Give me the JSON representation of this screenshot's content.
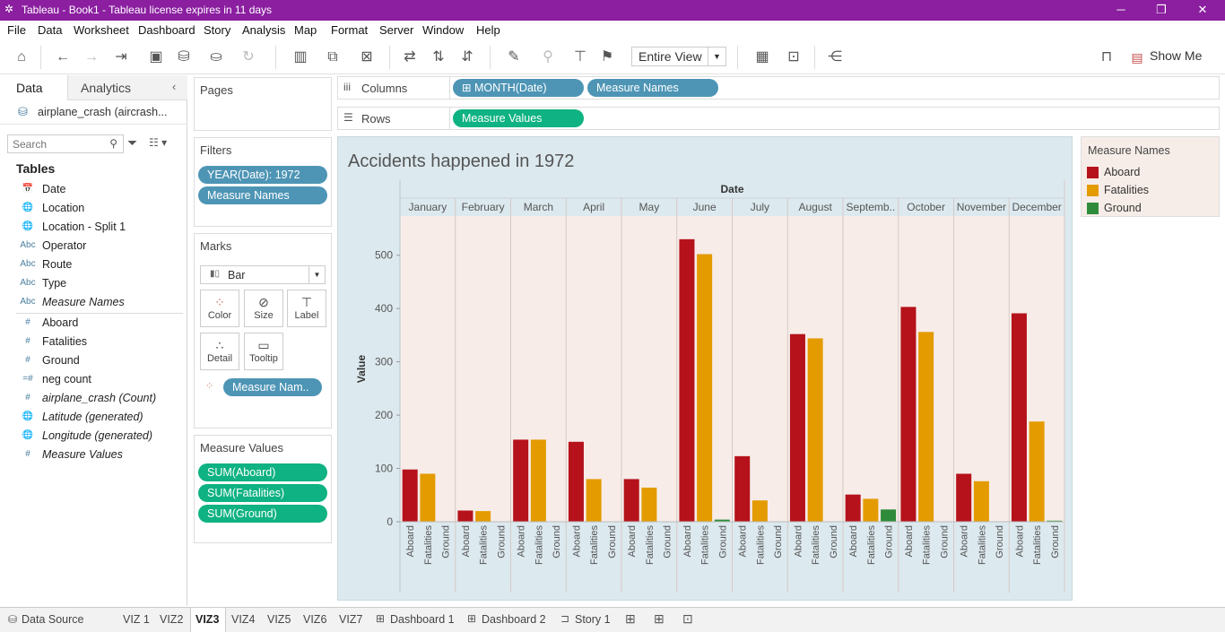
{
  "window": {
    "title": "Tableau - Book1 - Tableau license expires in 11 days",
    "controls": {
      "minimize": "─",
      "restore": "❐",
      "close": "✕"
    }
  },
  "menu": [
    "File",
    "Data",
    "Worksheet",
    "Dashboard",
    "Story",
    "Analysis",
    "Map",
    "Format",
    "Server",
    "Window",
    "Help"
  ],
  "toolbar": {
    "view_select": "Entire View",
    "show_me_label": "Show Me"
  },
  "left_panel": {
    "tabs": {
      "data": "Data",
      "analytics": "Analytics"
    },
    "datasource": "airplane_crash (aircrash...",
    "search_placeholder": "Search",
    "tables_header": "Tables",
    "dimensions": [
      {
        "icon": "📅",
        "name": "Date",
        "italic": false
      },
      {
        "icon": "🌐",
        "name": "Location",
        "italic": false
      },
      {
        "icon": "🌐",
        "name": "Location - Split 1",
        "italic": false
      },
      {
        "icon": "Abc",
        "name": "Operator",
        "italic": false
      },
      {
        "icon": "Abc",
        "name": "Route",
        "italic": false
      },
      {
        "icon": "Abc",
        "name": "Type",
        "italic": false
      },
      {
        "icon": "Abc",
        "name": "Measure Names",
        "italic": true
      }
    ],
    "measures": [
      {
        "icon": "#",
        "name": "Aboard",
        "italic": false
      },
      {
        "icon": "#",
        "name": "Fatalities",
        "italic": false
      },
      {
        "icon": "#",
        "name": "Ground",
        "italic": false
      },
      {
        "icon": "=#",
        "name": "neg count",
        "italic": false
      },
      {
        "icon": "#",
        "name": "airplane_crash (Count)",
        "italic": true
      },
      {
        "icon": "🌐",
        "name": "Latitude (generated)",
        "italic": true
      },
      {
        "icon": "🌐",
        "name": "Longitude (generated)",
        "italic": true
      },
      {
        "icon": "#",
        "name": "Measure Values",
        "italic": true
      }
    ]
  },
  "pages": {
    "header": "Pages"
  },
  "filters": {
    "header": "Filters",
    "items": [
      "YEAR(Date): 1972",
      "Measure Names"
    ]
  },
  "marks": {
    "header": "Marks",
    "mark_type": "Bar",
    "buttons": [
      "Color",
      "Size",
      "Label",
      "Detail",
      "Tooltip"
    ],
    "color_pill": "Measure Nam.."
  },
  "measure_values": {
    "header": "Measure Values",
    "items": [
      "SUM(Aboard)",
      "SUM(Fatalities)",
      "SUM(Ground)"
    ]
  },
  "shelves": {
    "columns_label": "Columns",
    "rows_label": "Rows",
    "columns_pills": [
      "⊞ MONTH(Date)",
      "Measure Names"
    ],
    "rows_pills": [
      "Measure Values"
    ]
  },
  "legend": {
    "title": "Measure Names",
    "items": [
      {
        "name": "Aboard",
        "color": "#b5121b"
      },
      {
        "name": "Fatalities",
        "color": "#e39b00"
      },
      {
        "name": "Ground",
        "color": "#2e8b3a"
      }
    ]
  },
  "chart_data": {
    "type": "bar",
    "title": "Accidents happened in 1972",
    "xlabel": "Date",
    "ylabel": "Value",
    "ylim": [
      0,
      560
    ],
    "yticks": [
      0,
      100,
      200,
      300,
      400,
      500
    ],
    "months": [
      "January",
      "February",
      "March",
      "April",
      "May",
      "June",
      "July",
      "August",
      "Septemb..",
      "October",
      "November",
      "December"
    ],
    "measures": [
      "Aboard",
      "Fatalities",
      "Ground"
    ],
    "colors": {
      "Aboard": "#b5121b",
      "Fatalities": "#e39b00",
      "Ground": "#2e8b3a"
    },
    "series": [
      {
        "name": "Aboard",
        "values": [
          98,
          21,
          154,
          150,
          80,
          530,
          123,
          352,
          51,
          403,
          90,
          391
        ]
      },
      {
        "name": "Fatalities",
        "values": [
          90,
          20,
          154,
          80,
          64,
          502,
          40,
          344,
          43,
          356,
          76,
          188
        ]
      },
      {
        "name": "Ground",
        "values": [
          0,
          0,
          0,
          0,
          0,
          4,
          0,
          0,
          23,
          0,
          0,
          2
        ]
      }
    ]
  },
  "bottom_tabs": [
    "Data Source",
    "VIZ 1",
    "VIZ2",
    "VIZ3",
    "VIZ4",
    "VIZ5",
    "VIZ6",
    "VIZ7",
    "Dashboard 1",
    "Dashboard 2",
    "Story 1"
  ],
  "active_tab": "VIZ3"
}
